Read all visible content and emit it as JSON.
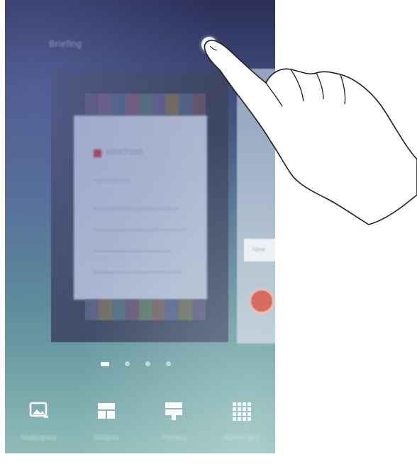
{
  "screen": {
    "title": "Briefing",
    "card_heading": "BRIEFING",
    "side_card_text": "New",
    "side_panel_text": "",
    "page_count": 4,
    "active_page": 0
  },
  "dock": [
    {
      "label": "Wallpapers",
      "icon": "wallpaper-icon"
    },
    {
      "label": "Widgets",
      "icon": "widgets-icon"
    },
    {
      "label": "Themes",
      "icon": "themes-icon"
    },
    {
      "label": "Screen grid",
      "icon": "grid-icon"
    }
  ],
  "colors": {
    "background_top": "#2b2f58",
    "background_bottom": "#8fbcb9",
    "accent_red": "#d64a3f"
  }
}
